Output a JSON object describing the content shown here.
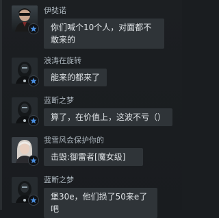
{
  "colors": {
    "background": "#1a1d20",
    "bubble": "#2f3438",
    "sender_text": "#aeb8c0",
    "message_text": "#e0e4e7",
    "badge_star": "#4a8fe0"
  },
  "messages": [
    {
      "sender": "伊奘诺",
      "text": "你们喊个10个人，对面都不敢来的",
      "avatar_icon": "masked-man-avatar-icon",
      "badge_icon": "star-badge-icon"
    },
    {
      "sender": "浪涛在旋转",
      "text": "能来的都来了",
      "avatar_icon": "helmet-avatar-icon",
      "badge_icon": "star-badge-icon"
    },
    {
      "sender": "蓝断之梦",
      "text": "算了，在价值上，这波不亏（）",
      "avatar_icon": "helmet-avatar-icon",
      "badge_icon": "star-badge-icon"
    },
    {
      "sender": "我雪风会保护你的",
      "text": "击毁:御雷者[魔女级]",
      "avatar_icon": "white-haired-woman-avatar-icon",
      "badge_icon": "star-badge-icon"
    },
    {
      "sender": "蓝断之梦",
      "text": "堡30e，他们损了50来e了吧",
      "avatar_icon": "helmet-avatar-icon",
      "badge_icon": "star-badge-icon"
    }
  ]
}
